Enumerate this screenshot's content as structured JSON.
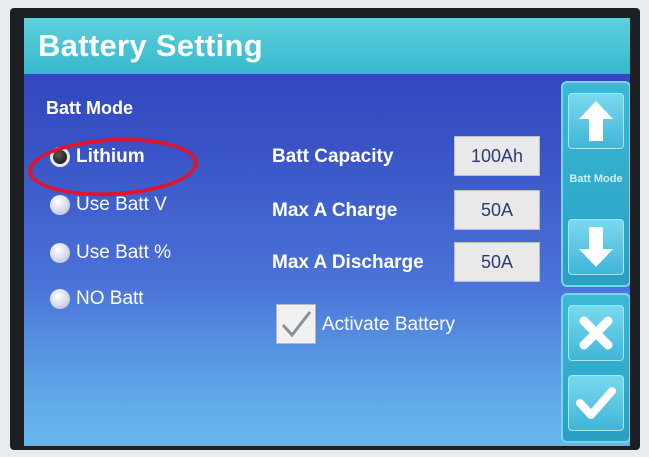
{
  "header": {
    "title": "Battery Setting"
  },
  "batt_mode": {
    "label": "Batt Mode",
    "options": [
      {
        "label": "Lithium",
        "selected": true
      },
      {
        "label": "Use Batt V",
        "selected": false
      },
      {
        "label": "Use Batt %",
        "selected": false
      },
      {
        "label": "NO Batt",
        "selected": false
      }
    ]
  },
  "fields": [
    {
      "label": "Batt Capacity",
      "value": "100Ah"
    },
    {
      "label": "Max A Charge",
      "value": "50A"
    },
    {
      "label": "Max A Discharge",
      "value": "50A"
    }
  ],
  "activate": {
    "label": "Activate Battery",
    "checked": true
  },
  "side": {
    "mode_label": "Batt Mode"
  },
  "colors": {
    "accent": "#35b9cc",
    "background": "#3953c6",
    "highlight": "#e0152b"
  },
  "icons": [
    "arrow-up-icon",
    "arrow-down-icon",
    "close-icon",
    "check-icon"
  ]
}
